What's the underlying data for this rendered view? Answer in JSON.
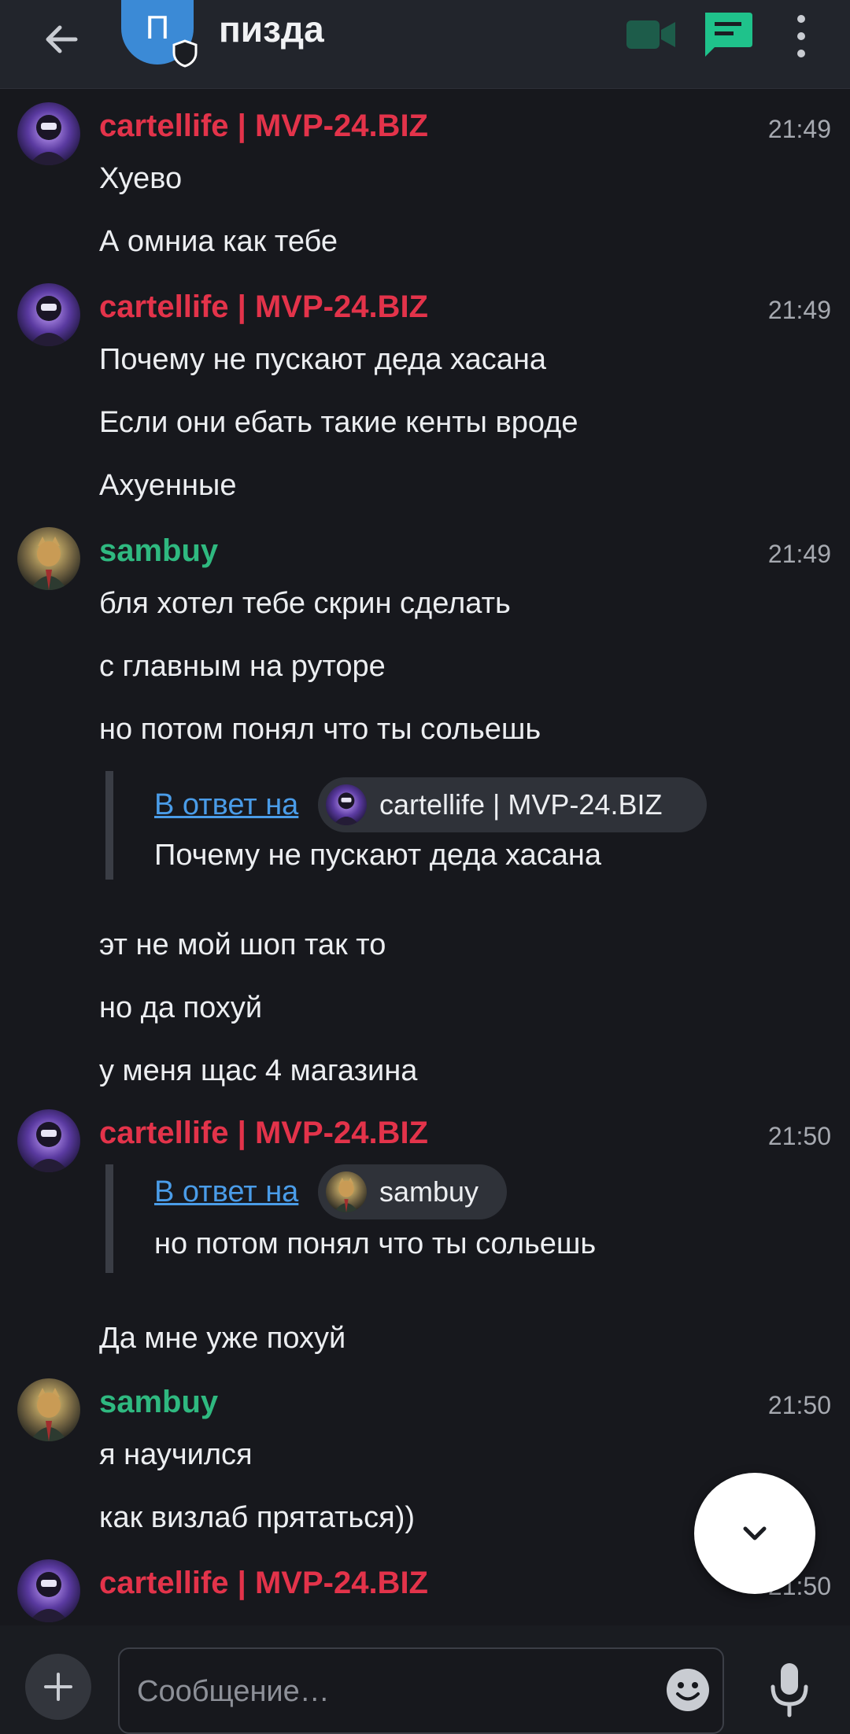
{
  "header": {
    "avatar_letter": "П",
    "title": "пизда"
  },
  "colors": {
    "author_red": "#e3334a",
    "author_green": "#2fb980",
    "link_blue": "#4a9ce8",
    "accent_green": "#1fc28b"
  },
  "messages": [
    {
      "author": "cartellife | MVP-24.BIZ",
      "time": "21:49",
      "lines": [
        "Хуево",
        "А омниа как тебе"
      ]
    },
    {
      "author": "cartellife | MVP-24.BIZ",
      "time": "21:49",
      "lines": [
        "Почему не пускают деда хасана",
        "Если они ебать такие кенты вроде",
        "Ахуенные"
      ]
    },
    {
      "author": "sambuy",
      "time": "21:49",
      "lines": [
        "бля хотел тебе скрин сделать",
        "с главным на руторе",
        "но потом понял что ты сольешь"
      ],
      "reply": {
        "link": "В ответ на",
        "to": "cartellife | MVP-24.BIZ",
        "text": "Почему не пускают деда хасана"
      },
      "after_lines": [
        "эт не мой шоп так то",
        "но да похуй",
        "у меня щас 4 магазина"
      ]
    },
    {
      "author": "cartellife | MVP-24.BIZ",
      "time": "21:50",
      "reply": {
        "link": "В ответ на",
        "to": "sambuy",
        "text": "но потом понял что ты сольешь"
      },
      "after_lines": [
        "Да мне уже похуй"
      ]
    },
    {
      "author": "sambuy",
      "time": "21:50",
      "lines": [
        "я научился",
        "как визлаб прятаться))"
      ]
    },
    {
      "author": "cartellife | MVP-24.BIZ",
      "time": "21:50"
    }
  ],
  "composer": {
    "placeholder": "Сообщение…"
  }
}
